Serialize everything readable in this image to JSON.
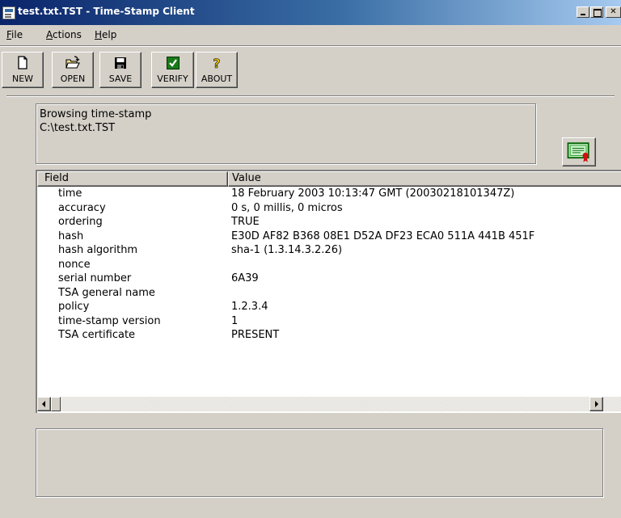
{
  "window": {
    "title": "test.txt.TST - Time-Stamp Client"
  },
  "menu": {
    "file": {
      "mnemonic": "F",
      "rest": "ile"
    },
    "actions": {
      "mnemonic": "A",
      "rest": "ctions"
    },
    "help": {
      "mnemonic": "H",
      "rest": "elp"
    }
  },
  "toolbar": {
    "new_label": "NEW",
    "open_label": "OPEN",
    "save_label": "SAVE",
    "verify_label": "VERIFY",
    "about_label": "ABOUT"
  },
  "info": {
    "line1": "Browsing time-stamp",
    "line2": "C:\\test.txt.TST"
  },
  "table": {
    "columns": {
      "field": "Field",
      "value": "Value"
    },
    "rows": [
      {
        "field": "time",
        "value": "18 February 2003  10:13:47 GMT (20030218101347Z)"
      },
      {
        "field": "accuracy",
        "value": "0 s, 0 millis, 0 micros"
      },
      {
        "field": "ordering",
        "value": "TRUE"
      },
      {
        "field": "hash",
        "value": "E30D AF82 B368 08E1 D52A DF23 ECA0 511A 441B 451F"
      },
      {
        "field": "hash algorithm",
        "value": "sha-1 (1.3.14.3.2.26)"
      },
      {
        "field": "nonce",
        "value": ""
      },
      {
        "field": "serial number",
        "value": "6A39"
      },
      {
        "field": "TSA general name",
        "value": ""
      },
      {
        "field": "policy",
        "value": "1.2.3.4"
      },
      {
        "field": "time-stamp version",
        "value": "1"
      },
      {
        "field": "TSA certificate",
        "value": "PRESENT"
      }
    ]
  },
  "icons": {
    "new": "new-document-icon",
    "open": "open-folder-icon",
    "save": "floppy-disk-icon",
    "verify": "green-check-icon",
    "about": "question-mark-icon",
    "certificate": "certificate-icon"
  },
  "colors": {
    "titlebar_start": "#0a246a",
    "titlebar_end": "#a6caf0",
    "window_face": "#d4d0c8"
  }
}
